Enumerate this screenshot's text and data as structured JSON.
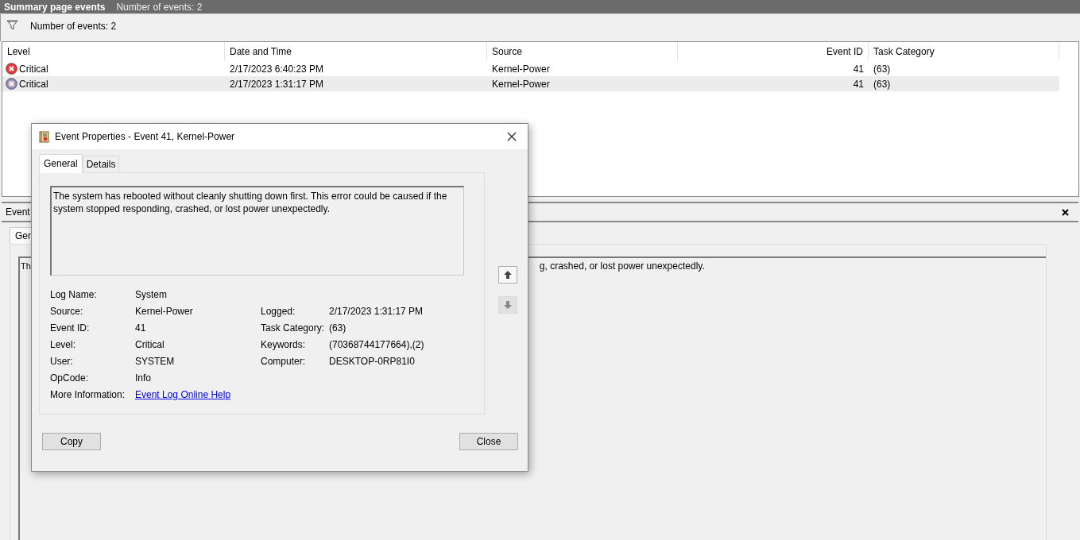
{
  "header": {
    "title": "Summary page events",
    "count": "Number of events: 2"
  },
  "filter_bar": {
    "count": "Number of events: 2"
  },
  "table": {
    "columns": [
      "Level",
      "Date and Time",
      "Source",
      "Event ID",
      "Task Category"
    ],
    "rows": [
      {
        "level": "Critical",
        "date_time": "2/17/2023 6:40:23 PM",
        "source": "Kernel-Power",
        "event_id": "41",
        "task_category": "(63)",
        "selected": false
      },
      {
        "level": "Critical",
        "date_time": "2/17/2023 1:31:17 PM",
        "source": "Kernel-Power",
        "event_id": "41",
        "task_category": "(63)",
        "selected": true
      }
    ]
  },
  "details_pane": {
    "title": "Event",
    "tabs": [
      {
        "label": "Gen",
        "selected": true
      }
    ],
    "text_start": "Th",
    "text_end": "g, crashed, or lost power unexpectedly."
  },
  "dialog": {
    "title": "Event Properties - Event 41, Kernel-Power",
    "tabs": [
      {
        "label": "General",
        "selected": true
      },
      {
        "label": "Details",
        "selected": false
      }
    ],
    "description": "The system has rebooted without cleanly shutting down first. This error could be caused if the system stopped responding, crashed, or lost power unexpectedly.",
    "nav_buttons": [
      {
        "kind": "up",
        "disabled": false
      },
      {
        "kind": "down",
        "disabled": true
      }
    ],
    "rows": [
      {
        "left": {
          "label": "Log Name:",
          "value": "System"
        }
      },
      {
        "left": {
          "label": "Source:",
          "value": "Kernel-Power"
        },
        "right": {
          "label": "Logged:",
          "value": "2/17/2023 1:31:17 PM"
        }
      },
      {
        "left": {
          "label": "Event ID:",
          "value": "41"
        },
        "right": {
          "label": "Task Category:",
          "value": "(63)"
        }
      },
      {
        "left": {
          "label": "Level:",
          "value": "Critical"
        },
        "right": {
          "label": "Keywords:",
          "value": "(70368744177664),(2)"
        }
      },
      {
        "left": {
          "label": "User:",
          "value": "SYSTEM"
        },
        "right": {
          "label": "Computer:",
          "value": "DESKTOP-0RP81I0"
        }
      },
      {
        "left": {
          "label": "OpCode:",
          "value": "Info"
        }
      }
    ],
    "more_info": {
      "label": "More Information:",
      "link": "Event Log Online Help"
    },
    "buttons": [
      "Copy",
      "Close"
    ]
  }
}
